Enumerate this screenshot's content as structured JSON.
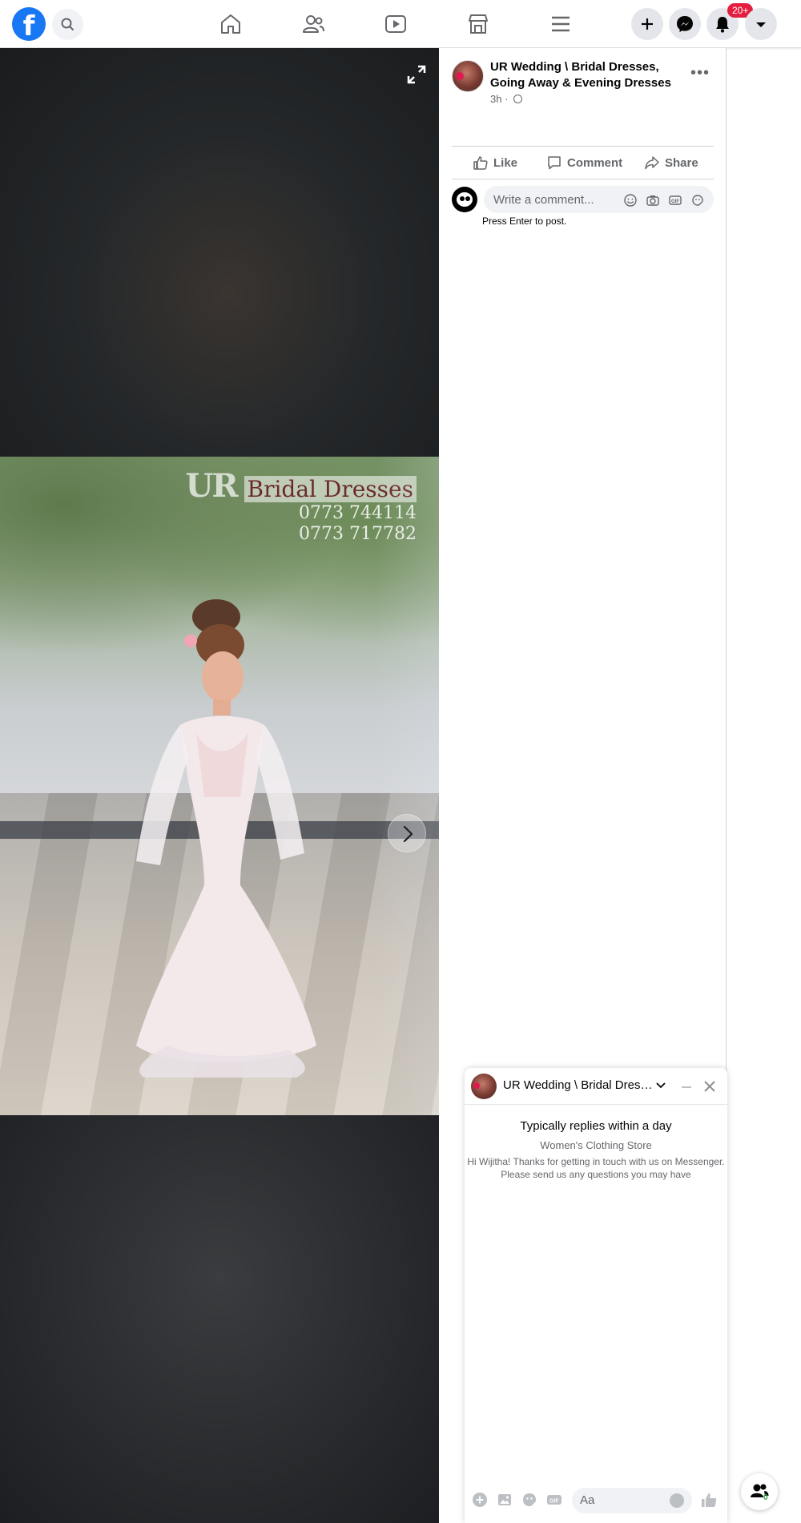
{
  "nav": {
    "logo": "f",
    "notification_badge": "20+"
  },
  "photo": {
    "watermark_brand_short": "UR",
    "watermark_brand": "Bridal Dresses",
    "watermark_phone_1": "0773 744114",
    "watermark_phone_2": "0773 717782"
  },
  "post": {
    "page_name": "UR Wedding \\ Bridal Dresses, Going Away & Evening Dresses",
    "time": "3h",
    "meta_separator": "·",
    "more_label": "•••",
    "actions": {
      "like": "Like",
      "comment": "Comment",
      "share": "Share"
    },
    "comment_placeholder": "Write a comment...",
    "press_enter_hint": "Press Enter to post."
  },
  "chat": {
    "title": "UR Wedding \\ Bridal Dresses, Going Away & Evening Dresses",
    "reply_time": "Typically replies within a day",
    "category": "Women's Clothing Store",
    "greeting": "Hi Wijitha! Thanks for getting in touch with us on Messenger. Please send us any questions you may have",
    "input_placeholder": "Aa"
  },
  "contacts": {
    "count": "0"
  },
  "colors": {
    "brand_blue": "#1877f2",
    "badge_red": "#e41e3f",
    "secondary_text": "#65676b",
    "online_green": "#31a24c"
  }
}
